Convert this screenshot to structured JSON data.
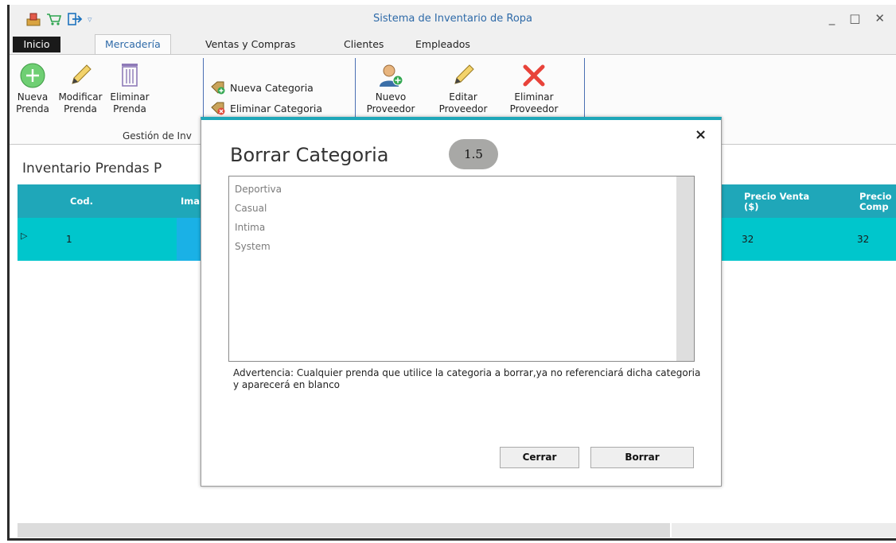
{
  "window": {
    "title": "Sistema de Inventario de Ropa",
    "minimize": "_",
    "maximize": "□",
    "close": "✕"
  },
  "tabs": [
    "Inicio",
    "Mercadería",
    "Ventas y Compras",
    "Clientes",
    "Empleados"
  ],
  "ribbon": {
    "nueva_prenda": [
      "Nueva",
      "Prenda"
    ],
    "modificar_prenda": [
      "Modificar",
      "Prenda"
    ],
    "eliminar_prenda": [
      "Eliminar",
      "Prenda"
    ],
    "nueva_categoria": "Nueva Categoria",
    "eliminar_categoria": "Eliminar Categoria",
    "nuevo_proveedor": [
      "Nuevo",
      "Proveedor"
    ],
    "editar_proveedor": [
      "Editar",
      "Proveedor"
    ],
    "eliminar_proveedor": [
      "Eliminar",
      "Proveedor"
    ],
    "group_label": "Gestión de Inv"
  },
  "content": {
    "title": "Inventario Prendas  P",
    "columns": [
      "Cod.",
      "Ima",
      "Precio Venta\n($)",
      "Precio\nComp"
    ],
    "row": {
      "cod": "1",
      "precio_venta": "32",
      "precio_compra": "32"
    }
  },
  "dialog": {
    "title": "Borrar Categoria",
    "badge": "1.5",
    "close": "×",
    "categories": [
      "Deportiva",
      "Casual",
      "Intima",
      "System"
    ],
    "warning": "Advertencia: Cualquier prenda que utilice la categoria a borrar,ya no referenciará dicha categoria y aparecerá en blanco",
    "cerrar": "Cerrar",
    "borrar": "Borrar"
  },
  "colors": {
    "accent": "#1fa7b9",
    "grid_row": "#00c6cc",
    "title_blue": "#2e6aa8",
    "badge": "#a8a8a6"
  }
}
